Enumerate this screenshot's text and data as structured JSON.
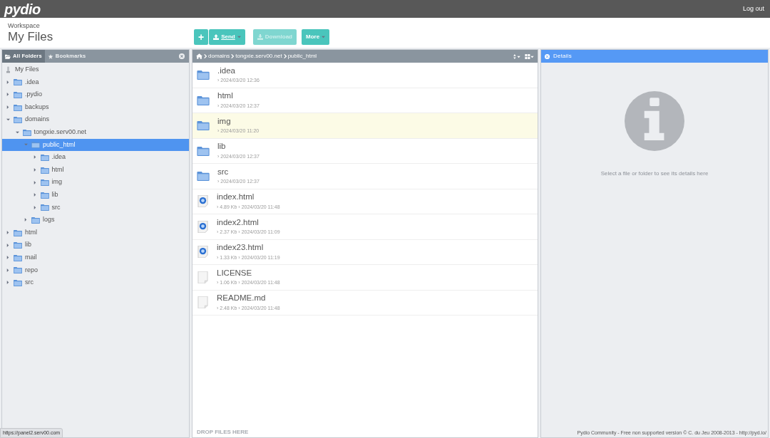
{
  "topbar": {
    "logo": "pydio",
    "logout": "Log out"
  },
  "header": {
    "workspace_label": "Workspace",
    "title": "My Files"
  },
  "toolbar": [
    {
      "kind": "icon",
      "label": "+",
      "disabled": false,
      "dropdown": false
    },
    {
      "kind": "upload",
      "label": "Send",
      "disabled": false,
      "dropdown": true
    },
    {
      "kind": "download",
      "label": "Download",
      "disabled": true,
      "dropdown": false
    },
    {
      "kind": "text",
      "label": "More",
      "disabled": false,
      "dropdown": true
    }
  ],
  "sidebar": {
    "tabs": [
      {
        "label": "All Folders",
        "selected": true
      },
      {
        "label": "Bookmarks",
        "selected": false
      }
    ],
    "tree": [
      {
        "label": "My Files",
        "kind": "root",
        "selected": false,
        "children": [
          {
            "label": ".idea",
            "kind": "folder",
            "expanded": false,
            "selected": false
          },
          {
            "label": ".pydio",
            "kind": "folder",
            "expanded": false,
            "selected": false
          },
          {
            "label": "backups",
            "kind": "folder",
            "expanded": false,
            "selected": false
          },
          {
            "label": "domains",
            "kind": "folder",
            "expanded": true,
            "selected": false,
            "children": [
              {
                "label": "tongxie.serv00.net",
                "kind": "folder",
                "expanded": true,
                "selected": false,
                "children": [
                  {
                    "label": "public_html",
                    "kind": "folder",
                    "expanded": true,
                    "selected": true,
                    "children": [
                      {
                        "label": ".idea",
                        "kind": "folder",
                        "expanded": false,
                        "selected": false
                      },
                      {
                        "label": "html",
                        "kind": "folder",
                        "expanded": false,
                        "selected": false
                      },
                      {
                        "label": "img",
                        "kind": "folder",
                        "expanded": false,
                        "selected": false
                      },
                      {
                        "label": "lib",
                        "kind": "folder",
                        "expanded": false,
                        "selected": false
                      },
                      {
                        "label": "src",
                        "kind": "folder",
                        "expanded": false,
                        "selected": false
                      }
                    ]
                  },
                  {
                    "label": "logs",
                    "kind": "folder",
                    "expanded": false,
                    "selected": false
                  }
                ]
              }
            ]
          },
          {
            "label": "html",
            "kind": "folder",
            "expanded": false,
            "selected": false
          },
          {
            "label": "lib",
            "kind": "folder",
            "expanded": false,
            "selected": false
          },
          {
            "label": "mail",
            "kind": "folder",
            "expanded": false,
            "selected": false
          },
          {
            "label": "repo",
            "kind": "folder",
            "expanded": false,
            "selected": false
          },
          {
            "label": "src",
            "kind": "folder",
            "expanded": false,
            "selected": false
          }
        ]
      }
    ]
  },
  "breadcrumb": [
    "domains",
    "tongxie.serv00.net",
    "public_html"
  ],
  "files": [
    {
      "name": ".idea",
      "kind": "folder",
      "meta": "› 2024/03/20 12:36",
      "highlighted": false
    },
    {
      "name": "html",
      "kind": "folder",
      "meta": "› 2024/03/20 12:37",
      "highlighted": false
    },
    {
      "name": "img",
      "kind": "folder",
      "meta": "› 2024/03/20 11:20",
      "highlighted": true
    },
    {
      "name": "lib",
      "kind": "folder",
      "meta": "› 2024/03/20 12:37",
      "highlighted": false
    },
    {
      "name": "src",
      "kind": "folder",
      "meta": "› 2024/03/20 12:37",
      "highlighted": false
    },
    {
      "name": "index.html",
      "kind": "web",
      "meta": "› 4.89 Kb › 2024/03/20 11:48",
      "highlighted": false
    },
    {
      "name": "index2.html",
      "kind": "web",
      "meta": "› 2.37 Kb › 2024/03/20 11:09",
      "highlighted": false
    },
    {
      "name": "index23.html",
      "kind": "web",
      "meta": "› 1.33 Kb › 2024/03/20 11:19",
      "highlighted": false
    },
    {
      "name": "LICENSE",
      "kind": "text",
      "meta": "› 1.06 Kb › 2024/03/20 11:48",
      "highlighted": false
    },
    {
      "name": "README.md",
      "kind": "text",
      "meta": "› 2.48 Kb › 2024/03/20 11:48",
      "highlighted": false
    }
  ],
  "drop_hint": "DROP FILES HERE",
  "details": {
    "title": "Details",
    "empty_message": "Select a file or folder to see its details here"
  },
  "status_url": "https://panel2.serv00.com",
  "footer": "Pydio Community - Free non supported version © C. du Jeu 2008-2013 - http://pyd.io/"
}
